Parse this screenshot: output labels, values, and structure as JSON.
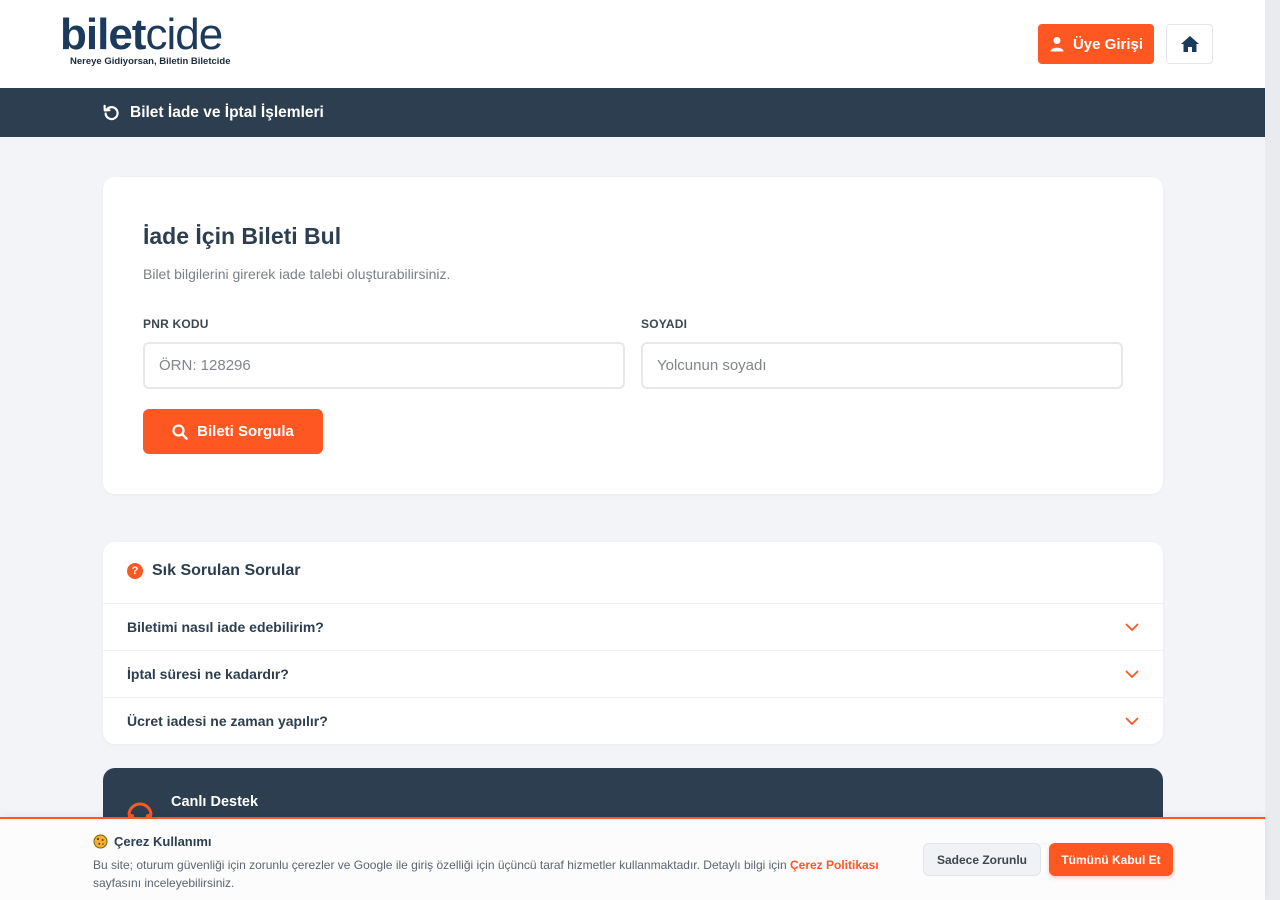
{
  "brand": {
    "name_bold": "bilet",
    "name_light": "cide",
    "tagline": "Nereye Gidiyorsan, Biletin Biletcide"
  },
  "header": {
    "login_label": "Üye Girişi",
    "login_icon": "user-icon",
    "home_icon": "home-icon"
  },
  "subnav": {
    "title": "Bilet İade ve İptal İşlemleri",
    "icon": "undo-icon"
  },
  "search": {
    "title": "İade İçin Bileti Bul",
    "subtitle": "Bilet bilgilerini girerek iade talebi oluşturabilirsiniz.",
    "pnr_label": "PNR KODU",
    "pnr_placeholder": "ÖRN: 128296",
    "pnr_value": "",
    "surname_label": "SOYADI",
    "surname_placeholder": "Yolcunun soyadı",
    "surname_value": "",
    "submit_label": "Bileti Sorgula",
    "submit_icon": "search-icon"
  },
  "faq": {
    "title": "Sık Sorulan Sorular",
    "items": [
      {
        "question": "Biletimi nasıl iade edebilirim?"
      },
      {
        "question": "İptal süresi ne kadardır?"
      },
      {
        "question": "Ücret iadesi ne zaman yapılır?"
      }
    ]
  },
  "support": {
    "title": "Canlı Destek",
    "icon": "headset-icon"
  },
  "cookie": {
    "title": "Çerez Kullanımı",
    "text_before": "Bu site; oturum güvenliği için zorunlu çerezler ve Google ile giriş özelliği için üçüncü taraf hizmetler kullanmaktadır. Detaylı bilgi için ",
    "link": "Çerez Politikası",
    "text_after": " sayfasını inceleyebilirsiniz.",
    "necessary_label": "Sadece Zorunlu",
    "accept_label": "Tümünü Kabul Et"
  },
  "colors": {
    "accent": "#ff5722",
    "navy": "#2c3e50",
    "logo": "#1c3a5c"
  }
}
